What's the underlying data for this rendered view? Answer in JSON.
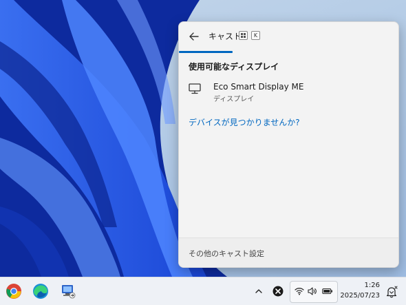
{
  "cast_panel": {
    "title": "キャスト",
    "shortcut_key": "K",
    "section_title": "使用可能なディスプレイ",
    "devices": [
      {
        "name": "Eco Smart Display ME",
        "type": "ディスプレイ",
        "icon": "monitor-icon"
      }
    ],
    "help_link": "デバイスが見つかりませんか?",
    "footer_link": "その他のキャスト設定",
    "accent_color": "#0067c0"
  },
  "taskbar": {
    "apps": [
      {
        "name": "Google Chrome",
        "icon": "chrome-icon"
      },
      {
        "name": "Microsoft Edge",
        "icon": "edge-icon"
      },
      {
        "name": "Remote Desktop",
        "icon": "remote-desktop-icon"
      }
    ],
    "tray_icons": [
      "wifi-icon",
      "speaker-icon",
      "battery-icon"
    ],
    "time": "1:26",
    "date": "2025/07/23"
  }
}
